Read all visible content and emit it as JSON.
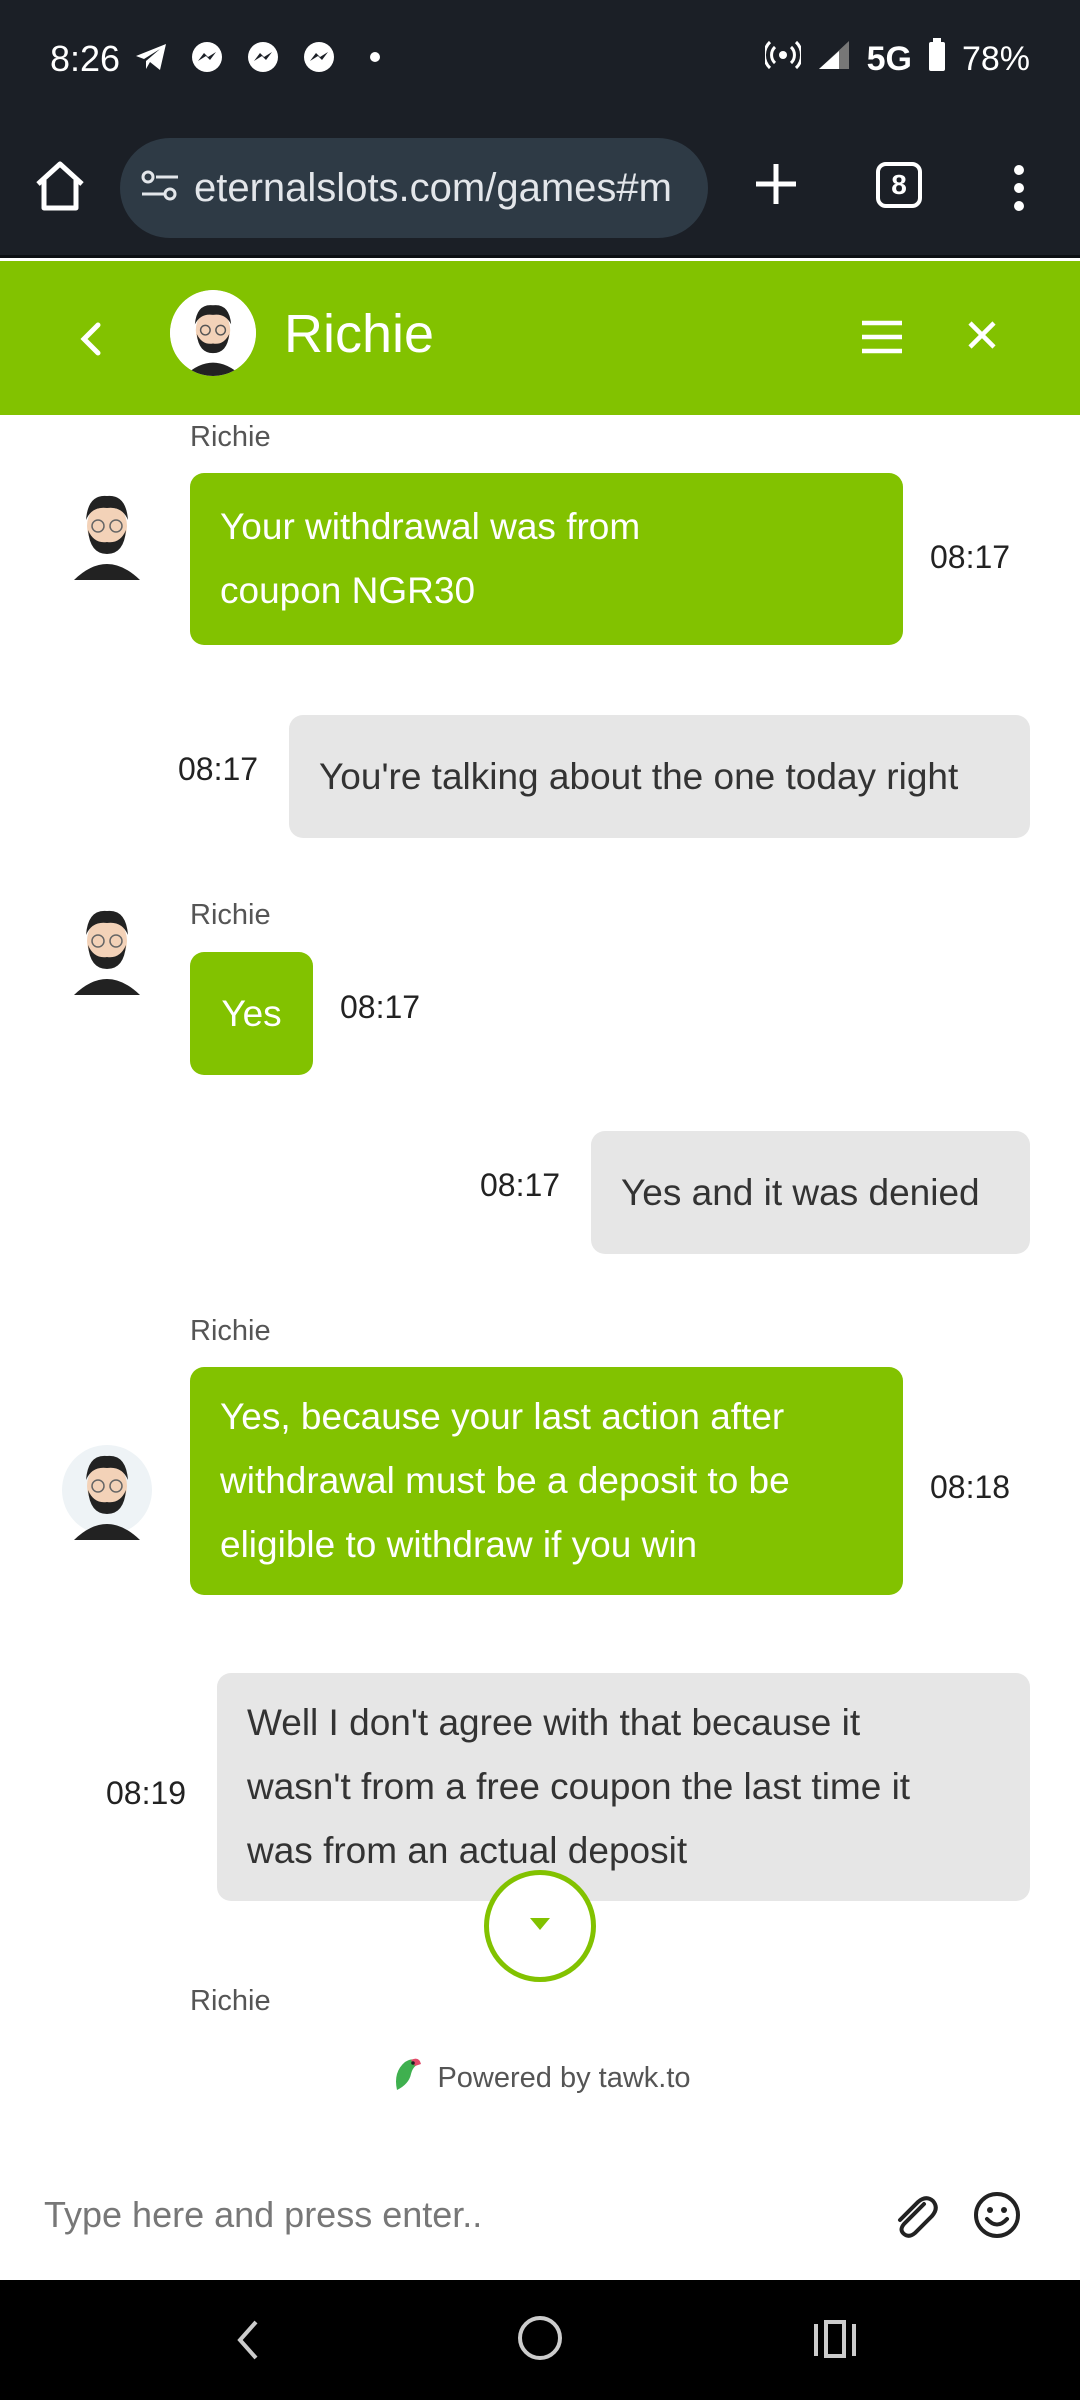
{
  "status_bar": {
    "time": "8:26",
    "network": "5G",
    "battery": "78%"
  },
  "browser": {
    "url": "eternalslots.com/games#m",
    "tab_count": "8"
  },
  "chat_header": {
    "agent_name": "Richie"
  },
  "messages": [
    {
      "sender": "agent",
      "name": "Richie",
      "lines": [
        "Your withdrawal was from",
        "coupon NGR30"
      ],
      "time": "08:17"
    },
    {
      "sender": "visitor",
      "lines": [
        "You're talking about the one today right"
      ],
      "time": "08:17"
    },
    {
      "sender": "agent",
      "name": "Richie",
      "lines": [
        "Yes"
      ],
      "time": "08:17"
    },
    {
      "sender": "visitor",
      "lines": [
        "Yes and it was denied"
      ],
      "time": "08:17"
    },
    {
      "sender": "agent",
      "name": "Richie",
      "lines": [
        "Yes, because your last action after",
        "withdrawal must be a deposit to be",
        "eligible to withdraw if you win"
      ],
      "time": "08:18"
    },
    {
      "sender": "visitor",
      "lines": [
        "Well I don't agree with that because it",
        "wasn't from a free coupon the last time it",
        "was from an actual deposit"
      ],
      "time": "08:19"
    },
    {
      "sender": "agent",
      "name": "Richie"
    }
  ],
  "powered_by": "Powered by tawk.to",
  "composer": {
    "placeholder": "Type here and press enter.."
  },
  "colors": {
    "brand_green": "#82c200",
    "visitor_bubble": "#e6e6e6",
    "dark_chrome": "#1b1f26"
  }
}
